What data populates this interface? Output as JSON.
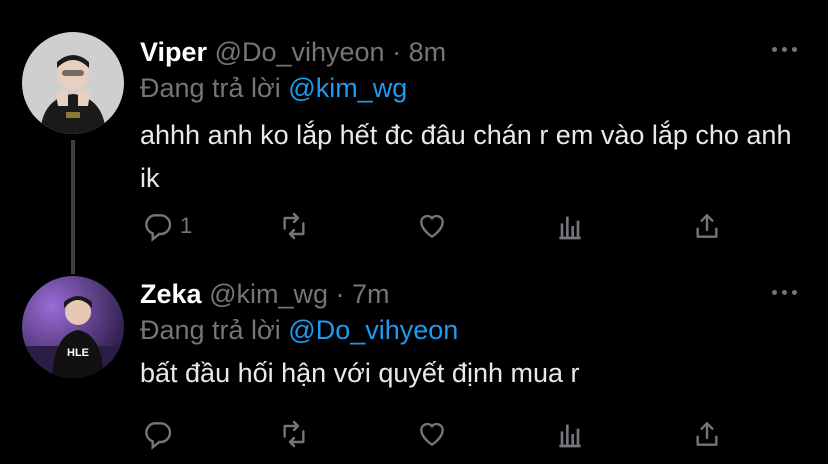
{
  "tweets": [
    {
      "display_name": "Viper",
      "handle": "@Do_vihyeon",
      "separator": "·",
      "time": "8m",
      "reply_label": "Đang trả lời",
      "reply_mention": "@kim_wg",
      "text": "ahhh anh ko lắp hết đc đâu chán r em vào lắp cho anh ik",
      "reply_count": "1",
      "avatar_icon": "profile-photo"
    },
    {
      "display_name": "Zeka",
      "handle": "@kim_wg",
      "separator": "·",
      "time": "7m",
      "reply_label": "Đang trả lời",
      "reply_mention": "@Do_vihyeon",
      "text": "bất đầu hối hận với quyết định mua r",
      "reply_count": "",
      "avatar_icon": "profile-photo"
    }
  ],
  "colors": {
    "background": "#000000",
    "accent": "#1d9bf0",
    "muted": "#72767b",
    "text": "#e7e9ea"
  },
  "icons": [
    "reply-icon",
    "retweet-icon",
    "like-icon",
    "analytics-icon",
    "share-icon",
    "more-icon"
  ]
}
